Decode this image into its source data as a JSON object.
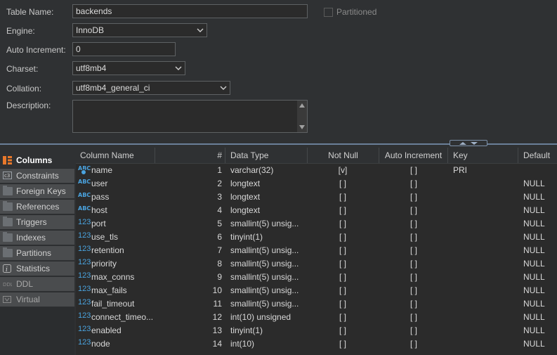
{
  "form": {
    "table_name": {
      "label": "Table Name:",
      "value": "backends"
    },
    "partitioned": {
      "label": "Partitioned"
    },
    "engine": {
      "label": "Engine:",
      "value": "InnoDB"
    },
    "auto_increment": {
      "label": "Auto Increment:",
      "value": "0"
    },
    "charset": {
      "label": "Charset:",
      "value": "utf8mb4"
    },
    "collation": {
      "label": "Collation:",
      "value": "utf8mb4_general_ci"
    },
    "description": {
      "label": "Description:",
      "value": ""
    }
  },
  "tabs": [
    {
      "label": "Columns",
      "icon": "columns-icon"
    },
    {
      "label": "Constraints",
      "icon": "constraints-icon"
    },
    {
      "label": "Foreign Keys",
      "icon": "folder-icon"
    },
    {
      "label": "References",
      "icon": "folder-icon"
    },
    {
      "label": "Triggers",
      "icon": "folder-icon"
    },
    {
      "label": "Indexes",
      "icon": "folder-icon"
    },
    {
      "label": "Partitions",
      "icon": "folder-icon"
    },
    {
      "label": "Statistics",
      "icon": "info-icon"
    },
    {
      "label": "DDL",
      "icon": "ddl-icon"
    },
    {
      "label": "Virtual",
      "icon": "virtual-icon"
    }
  ],
  "headers": [
    "Column Name",
    "#",
    "Data Type",
    "Not Null",
    "Auto Increment",
    "Key",
    "Default"
  ],
  "rows": [
    {
      "name": "name",
      "num": "1",
      "type": "varchar(32)",
      "notnull": "[v]",
      "ai": "[ ]",
      "key": "PRI",
      "def": "",
      "icon": "text-key"
    },
    {
      "name": "user",
      "num": "2",
      "type": "longtext",
      "notnull": "[ ]",
      "ai": "[ ]",
      "key": "",
      "def": "NULL",
      "icon": "text"
    },
    {
      "name": "pass",
      "num": "3",
      "type": "longtext",
      "notnull": "[ ]",
      "ai": "[ ]",
      "key": "",
      "def": "NULL",
      "icon": "text"
    },
    {
      "name": "host",
      "num": "4",
      "type": "longtext",
      "notnull": "[ ]",
      "ai": "[ ]",
      "key": "",
      "def": "NULL",
      "icon": "text"
    },
    {
      "name": "port",
      "num": "5",
      "type": "smallint(5) unsig...",
      "notnull": "[ ]",
      "ai": "[ ]",
      "key": "",
      "def": "NULL",
      "icon": "number"
    },
    {
      "name": "use_tls",
      "num": "6",
      "type": "tinyint(1)",
      "notnull": "[ ]",
      "ai": "[ ]",
      "key": "",
      "def": "NULL",
      "icon": "number"
    },
    {
      "name": "retention",
      "num": "7",
      "type": "smallint(5) unsig...",
      "notnull": "[ ]",
      "ai": "[ ]",
      "key": "",
      "def": "NULL",
      "icon": "number"
    },
    {
      "name": "priority",
      "num": "8",
      "type": "smallint(5) unsig...",
      "notnull": "[ ]",
      "ai": "[ ]",
      "key": "",
      "def": "NULL",
      "icon": "number"
    },
    {
      "name": "max_conns",
      "num": "9",
      "type": "smallint(5) unsig...",
      "notnull": "[ ]",
      "ai": "[ ]",
      "key": "",
      "def": "NULL",
      "icon": "number"
    },
    {
      "name": "max_fails",
      "num": "10",
      "type": "smallint(5) unsig...",
      "notnull": "[ ]",
      "ai": "[ ]",
      "key": "",
      "def": "NULL",
      "icon": "number"
    },
    {
      "name": "fail_timeout",
      "num": "11",
      "type": "smallint(5) unsig...",
      "notnull": "[ ]",
      "ai": "[ ]",
      "key": "",
      "def": "NULL",
      "icon": "number"
    },
    {
      "name": "connect_timeo...",
      "num": "12",
      "type": "int(10) unsigned",
      "notnull": "[ ]",
      "ai": "[ ]",
      "key": "",
      "def": "NULL",
      "icon": "number"
    },
    {
      "name": "enabled",
      "num": "13",
      "type": "tinyint(1)",
      "notnull": "[ ]",
      "ai": "[ ]",
      "key": "",
      "def": "NULL",
      "icon": "number"
    },
    {
      "name": "node",
      "num": "14",
      "type": "int(10)",
      "notnull": "[ ]",
      "ai": "[ ]",
      "key": "",
      "def": "NULL",
      "icon": "number"
    }
  ],
  "colors": {
    "accent": "#4aa3df",
    "background": "#2f3133",
    "divider": "#6a7f99",
    "columns_icon": "#e8782a"
  }
}
